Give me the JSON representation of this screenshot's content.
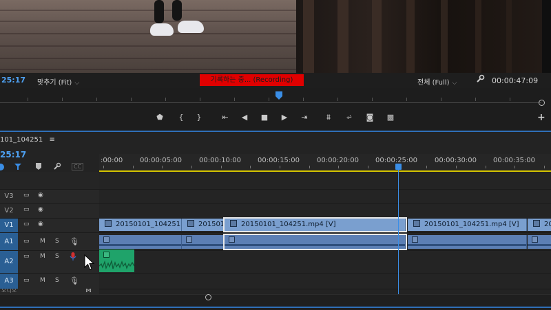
{
  "monitor": {
    "current_timecode": "25:17",
    "fit_label": "맞추기 (Fit)",
    "recording_label": "기록하는 중... (Recording)",
    "resolution_label": "전체 (Full)",
    "duration_timecode": "00:00:47:09"
  },
  "transport": {
    "add_label": "+"
  },
  "timeline": {
    "sequence_name": "101_104251",
    "menu_glyph": "≡",
    "current_timecode": "25:17",
    "ruler_labels": [
      ":00:00",
      "00:00:05:00",
      "00:00:10:00",
      "00:00:15:00",
      "00:00:20:00",
      "00:00:25:00",
      "00:00:30:00",
      "00:00:35:00"
    ],
    "tracks": {
      "v3": "V3",
      "v2": "V2",
      "v1": "V1",
      "a1": "A1",
      "a2": "A2",
      "a3": "A3"
    },
    "toggle_m": "M",
    "toggle_s": "S",
    "cc_label": "CC",
    "clips": {
      "v1_clip1": "20150101_104251",
      "v1_clip2": "201501",
      "v1_clip3": "20150101_104251.mp4 [V]",
      "v1_clip4": "20150101_104251.mp4 [V]",
      "v1_clip5": "20"
    },
    "bottom_label": "오디오"
  },
  "colors": {
    "playhead": "#3a8ee6",
    "recording": "#e00000",
    "video_clip": "#7a9fcf",
    "audio_clip": "#5c7fb4",
    "green_clip": "#1fa36a",
    "work_area": "#d4c400"
  }
}
